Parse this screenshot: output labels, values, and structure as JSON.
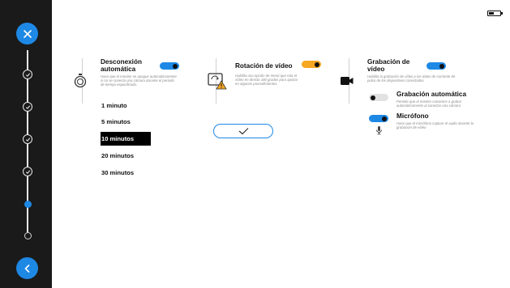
{
  "sidebar": {
    "close_icon": "close-icon",
    "back_icon": "chevron-left-icon",
    "steps": [
      "done",
      "done",
      "done",
      "done",
      "current",
      "pending"
    ],
    "accent": "#1e88e5"
  },
  "status": {
    "battery_icon": "battery-icon"
  },
  "auto_disconnect": {
    "title_line1": "Desconexión",
    "title_line2": "automática",
    "description": "Hace que el monitor se apague automáticamente si no se conecta una cámara durante el periodo de tiempo especificado.",
    "enabled": true,
    "icon": "timer-icon",
    "options": [
      "1 minuto",
      "5 minutos",
      "10 minutos",
      "20 minutos",
      "30 minutos"
    ],
    "selected_index": 2
  },
  "video_rotation": {
    "title": "Rotación de vídeo",
    "description": "Habilita una opción de menú que rota el vídeo en directo 180 grados para ajustar en algunos procedimientos.",
    "enabled": true,
    "icon": "screen-rotation-warning-icon",
    "accent": "#f5a623"
  },
  "video_recording": {
    "title_line1": "Grabación de",
    "title_line2": "vídeo",
    "description": "Habilita la grabación de vídeo y los datos de corriente de pulso de los dispositivos conectados.",
    "enabled": true,
    "icon": "video-camera-icon",
    "auto_record": {
      "title": "Grabación automática",
      "description": "Permite que el monitor comience a grabar automáticamente al conectar una cámara",
      "enabled": false
    },
    "microphone": {
      "title": "Micrófono",
      "description": "Hace que el micrófono capture el audio durante la grabación de vídeo",
      "enabled": true,
      "icon": "microphone-icon"
    }
  },
  "confirm_icon": "checkmark-icon"
}
